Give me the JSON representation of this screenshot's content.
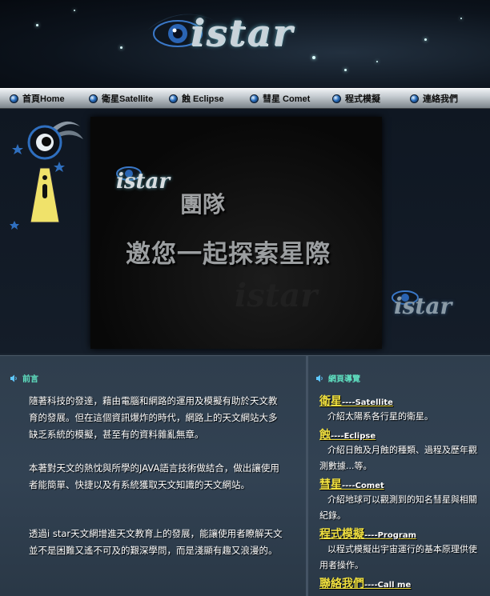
{
  "header": {
    "logo_text": "istar"
  },
  "nav": {
    "items": [
      {
        "label": "首頁Home"
      },
      {
        "label": "衛星Satellite"
      },
      {
        "label": "蝕 Eclipse"
      },
      {
        "label": "彗星 Comet"
      },
      {
        "label": "程式模擬"
      },
      {
        "label": "連絡我們"
      }
    ]
  },
  "banner": {
    "logo_text": "istar",
    "team_text": "團隊",
    "slogan": "邀您一起探索星際",
    "watermark_text": "istar"
  },
  "side_logo": "istar",
  "intro": {
    "title": "前言",
    "paragraphs": [
      "隨著科技的發達，藉由電腦和網路的運用及模擬有助於天文教育的發展。但在這個資訊爆炸的時代，網路上的天文網站大多缺乏系統的模擬，甚至有的資料雜亂無章。",
      "本著對天文的熱忱與所學的JAVA語言技術做結合，做出讓使用者能簡單、快捷以及有系統獲取天文知識的天文網站。",
      "透過i star天文網增進天文教育上的發展，能讓使用者瞭解天文並不是困難又遙不可及的艱深學問，而是淺顯有趣又浪漫的。"
    ]
  },
  "guide": {
    "title": "網頁導覽",
    "items": [
      {
        "name": "衛星",
        "sub": "----Satellite",
        "desc": "介紹太陽系各行星的衛星。"
      },
      {
        "name": "蝕",
        "sub": "----Eclipse",
        "desc": "介紹日蝕及月蝕的種類、過程及歷年觀測數據...等。"
      },
      {
        "name": "彗星",
        "sub": "----Comet",
        "desc": "介紹地球可以觀測到的知名彗星與相關紀錄。"
      },
      {
        "name": "程式模擬",
        "sub": "----Program",
        "desc": "以程式模擬出宇宙運行的基本原理供使用者操作。"
      },
      {
        "name": "聯絡我們",
        "sub": "----Call me",
        "desc": ""
      }
    ]
  }
}
